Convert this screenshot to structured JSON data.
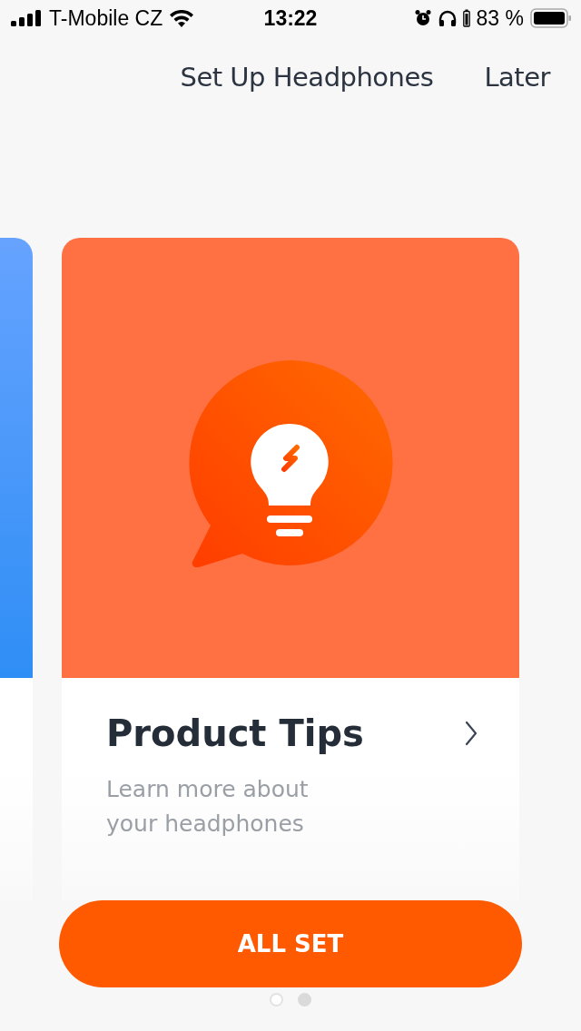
{
  "status_bar": {
    "carrier": "T-Mobile CZ",
    "time": "13:22",
    "battery_percent": "83 %"
  },
  "header": {
    "title": "Set Up Headphones",
    "action": "Later"
  },
  "cards": [
    {
      "kind": "partial"
    },
    {
      "kind": "full",
      "title": "Product Tips",
      "subtitle": "Learn more about your headphones"
    }
  ],
  "button": {
    "label": "ALL SET"
  },
  "page_dots": [
    {
      "selected": false
    },
    {
      "selected": true
    }
  ]
}
